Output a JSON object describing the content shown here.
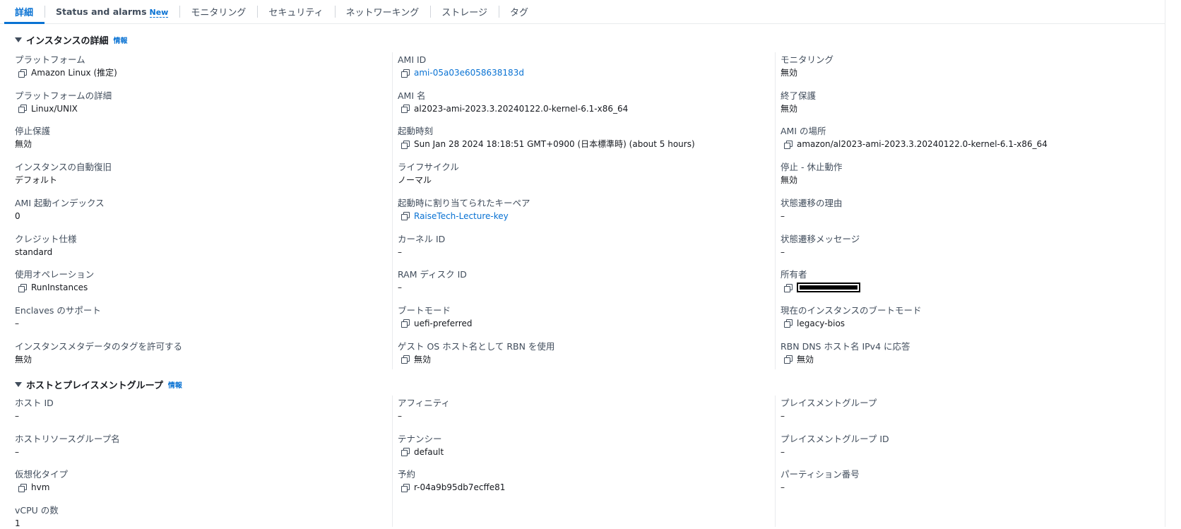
{
  "tabs": [
    {
      "label": "詳細",
      "active": true
    },
    {
      "label": "Status and alarms",
      "badge": "New"
    },
    {
      "label": "モニタリング"
    },
    {
      "label": "セキュリティ"
    },
    {
      "label": "ネットワーキング"
    },
    {
      "label": "ストレージ"
    },
    {
      "label": "タグ"
    }
  ],
  "instance_details": {
    "title": "インスタンスの詳細",
    "info": "情報",
    "col1": [
      {
        "label": "プラットフォーム",
        "value": "Amazon Linux (推定)",
        "copy": true
      },
      {
        "label": "プラットフォームの詳細",
        "value": "Linux/UNIX",
        "copy": true
      },
      {
        "label": "停止保護",
        "value": "無効"
      },
      {
        "label": "インスタンスの自動復旧",
        "value": "デフォルト"
      },
      {
        "label": "AMI 起動インデックス",
        "value": "0"
      },
      {
        "label": "クレジット仕様",
        "value": "standard"
      },
      {
        "label": "使用オペレーション",
        "value": "RunInstances",
        "copy": true
      },
      {
        "label": "Enclaves のサポート",
        "value": "–"
      },
      {
        "label": "インスタンスメタデータのタグを許可する",
        "value": "無効"
      }
    ],
    "col2": [
      {
        "label": "AMI ID",
        "value": "ami-05a03e6058638183d",
        "copy": true,
        "link": true
      },
      {
        "label": "AMI 名",
        "value": "al2023-ami-2023.3.20240122.0-kernel-6.1-x86_64",
        "copy": true
      },
      {
        "label": "起動時刻",
        "value": "Sun Jan 28 2024 18:18:51 GMT+0900 (日本標準時) (about 5 hours)",
        "copy": true
      },
      {
        "label": "ライフサイクル",
        "value": "ノーマル"
      },
      {
        "label": "起動時に割り当てられたキーペア",
        "value": "RaiseTech-Lecture-key",
        "copy": true,
        "link": true
      },
      {
        "label": "カーネル ID",
        "value": "–"
      },
      {
        "label": "RAM ディスク ID",
        "value": "–"
      },
      {
        "label": "ブートモード",
        "value": "uefi-preferred",
        "copy": true
      },
      {
        "label": "ゲスト OS ホスト名として RBN を使用",
        "value": "無効",
        "copy": true
      }
    ],
    "col3": [
      {
        "label": "モニタリング",
        "value": "無効"
      },
      {
        "label": "終了保護",
        "value": "無効"
      },
      {
        "label": "AMI の場所",
        "value": "amazon/al2023-ami-2023.3.20240122.0-kernel-6.1-x86_64",
        "copy": true
      },
      {
        "label": "停止 - 休止動作",
        "value": "無効"
      },
      {
        "label": "状態遷移の理由",
        "value": "–"
      },
      {
        "label": "状態遷移メッセージ",
        "value": "–"
      },
      {
        "label": "所有者",
        "value": "",
        "copy": true,
        "redacted": true
      },
      {
        "label": "現在のインスタンスのブートモード",
        "value": "legacy-bios",
        "copy": true
      },
      {
        "label": "RBN DNS ホスト名 IPv4 に応答",
        "value": "無効",
        "copy": true
      }
    ]
  },
  "host_placement": {
    "title": "ホストとプレイスメントグループ",
    "info": "情報",
    "col1": [
      {
        "label": "ホスト ID",
        "value": "–"
      },
      {
        "label": "ホストリソースグループ名",
        "value": "–"
      },
      {
        "label": "仮想化タイプ",
        "value": "hvm",
        "copy": true
      },
      {
        "label": "vCPU の数",
        "value": "1"
      }
    ],
    "col2": [
      {
        "label": "アフィニティ",
        "value": "–"
      },
      {
        "label": "テナンシー",
        "value": "default",
        "copy": true
      },
      {
        "label": "予約",
        "value": "r-04a9b95db7ecffe81",
        "copy": true
      }
    ],
    "col3": [
      {
        "label": "プレイスメントグループ",
        "value": "–"
      },
      {
        "label": "プレイスメントグループ ID",
        "value": "–"
      },
      {
        "label": "パーティション番号",
        "value": "–"
      }
    ]
  }
}
